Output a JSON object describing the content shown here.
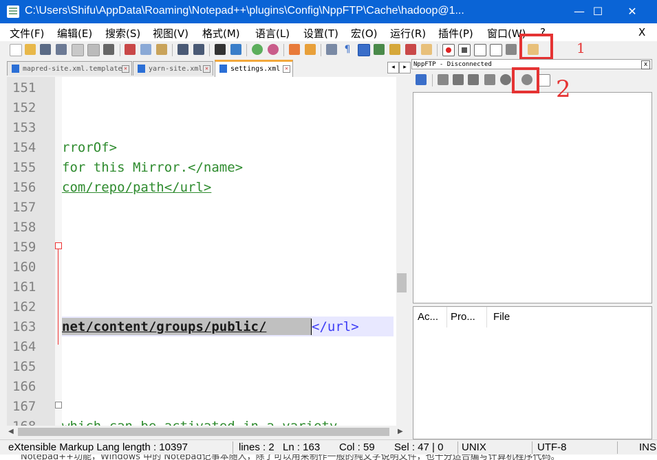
{
  "window": {
    "title": "C:\\Users\\Shifu\\AppData\\Roaming\\Notepad++\\plugins\\Config\\NppFTP\\Cache\\hadoop@1...",
    "min": "—",
    "max": "☐",
    "close": "✕"
  },
  "menu": {
    "items": [
      "文件(F)",
      "编辑(E)",
      "搜索(S)",
      "视图(V)",
      "格式(M)",
      "语言(L)",
      "设置(T)",
      "宏(O)",
      "运行(R)",
      "插件(P)",
      "窗口(W)",
      "?"
    ],
    "close": "X"
  },
  "tabs": [
    {
      "label": "mapred-site.xml.template",
      "active": false
    },
    {
      "label": "yarn-site.xml",
      "active": false
    },
    {
      "label": "settings.xml",
      "active": true
    }
  ],
  "editor": {
    "lines": [
      {
        "num": "151",
        "text": ""
      },
      {
        "num": "152",
        "text": ""
      },
      {
        "num": "153",
        "text": ""
      },
      {
        "num": "154",
        "text": "rrorOf>"
      },
      {
        "num": "155",
        "text": "for this Mirror.</name>"
      },
      {
        "num": "156",
        "text": "com/repo/path</url>"
      },
      {
        "num": "157",
        "text": ""
      },
      {
        "num": "158",
        "text": ""
      },
      {
        "num": "159",
        "text": ""
      },
      {
        "num": "160",
        "text": ""
      },
      {
        "num": "161",
        "text": ""
      },
      {
        "num": "162",
        "text": ""
      },
      {
        "num": "163",
        "text": "net/content/groups/public/"
      },
      {
        "num": "164",
        "text": ""
      },
      {
        "num": "165",
        "text": ""
      },
      {
        "num": "166",
        "text": ""
      },
      {
        "num": "167",
        "text": ""
      },
      {
        "num": "168",
        "text": "which can be activated in a variety"
      }
    ],
    "line163_tail": "</url>"
  },
  "ftp": {
    "title": "NppFTP - Disconnected",
    "close": "x",
    "queue_headers": [
      "Ac...",
      "Pro...",
      "File"
    ]
  },
  "annotations": {
    "one": "1",
    "two": "2"
  },
  "status": {
    "lang": "eXtensible Markup Lang length : 10397",
    "lines": "lines : 2",
    "ln": "Ln : 163",
    "col": "Col : 59",
    "sel": "Sel : 47 | 0",
    "eol": "UNIX",
    "encoding": "UTF-8",
    "mode": "INS"
  },
  "bottom_text": "Notepad++功能，Windows 中的 Notepad记事本随人，除了可以用来制作一般的纯文字说明文件，也十分适合编写计算机程序代码。"
}
